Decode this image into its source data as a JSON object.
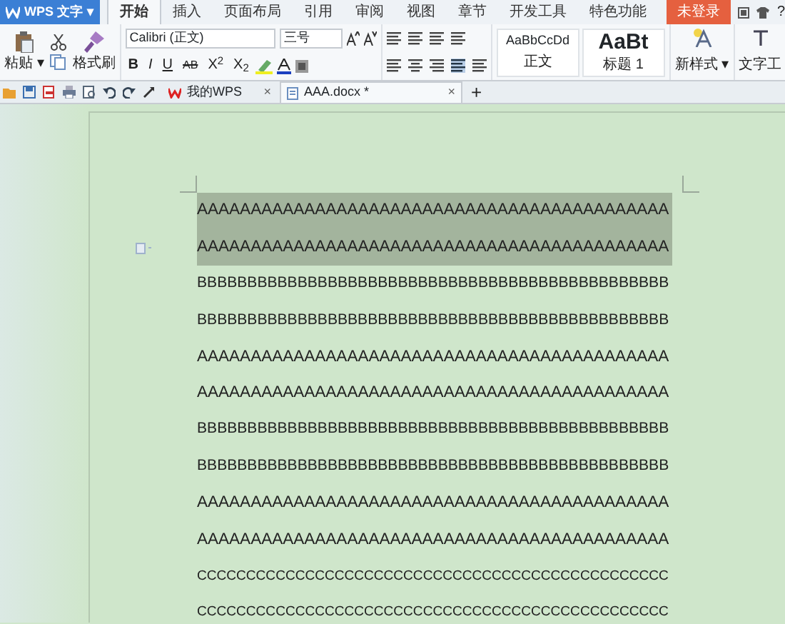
{
  "app_menu": {
    "label": "WPS 文字",
    "caret": "▾"
  },
  "ribbon_tabs": [
    {
      "label": "开始",
      "selected": true
    },
    {
      "label": "插入",
      "selected": false
    },
    {
      "label": "页面布局",
      "selected": false
    },
    {
      "label": "引用",
      "selected": false
    },
    {
      "label": "审阅",
      "selected": false
    },
    {
      "label": "视图",
      "selected": false
    },
    {
      "label": "章节",
      "selected": false
    },
    {
      "label": "开发工具",
      "selected": false
    },
    {
      "label": "特色功能",
      "selected": false
    }
  ],
  "login_button": "未登录",
  "help": "?",
  "ribbon": {
    "paste": "粘贴",
    "paste_caret": "▾",
    "format_painter": "格式刷",
    "font_name": "Calibri (正文)",
    "font_size": "三号",
    "format_buttons": [
      "B",
      "I",
      "U",
      "AB",
      "X$^{2}$",
      "X$_{2}$"
    ],
    "styles": [
      {
        "sample": "AaBbCcDd",
        "label": "正文",
        "kind": "small"
      },
      {
        "sample": "AaBt",
        "label": "标题 1",
        "kind": "large"
      }
    ],
    "new_style": "新样式",
    "new_style_caret": "▾",
    "text_tools": "文字工"
  },
  "doc_tabs": [
    {
      "label": "我的WPS",
      "close": "×",
      "selected": false
    },
    {
      "label": "AAA.docx *",
      "close": "×",
      "selected": true
    }
  ],
  "new_tab": "+",
  "lines": [
    {
      "text": "AAAAAAAAAAAAAAAAAAAAAAAAAAAAAAAAAAAAAAAAAAAA",
      "selected": true
    },
    {
      "text": "AAAAAAAAAAAAAAAAAAAAAAAAAAAAAAAAAAAAAAAAAAAA",
      "selected": true
    },
    {
      "text": "BBBBBBBBBBBBBBBBBBBBBBBBBBBBBBBBBBBBBBBBBBBBBBB",
      "selected": false
    },
    {
      "text": "BBBBBBBBBBBBBBBBBBBBBBBBBBBBBBBBBBBBBBBBBBBBBBB",
      "selected": false
    },
    {
      "text": "AAAAAAAAAAAAAAAAAAAAAAAAAAAAAAAAAAAAAAAAAAAA",
      "selected": false
    },
    {
      "text": "AAAAAAAAAAAAAAAAAAAAAAAAAAAAAAAAAAAAAAAAAAAA",
      "selected": false
    },
    {
      "text": "BBBBBBBBBBBBBBBBBBBBBBBBBBBBBBBBBBBBBBBBBBBBBBB",
      "selected": false
    },
    {
      "text": "BBBBBBBBBBBBBBBBBBBBBBBBBBBBBBBBBBBBBBBBBBBBBBB",
      "selected": false
    },
    {
      "text": "AAAAAAAAAAAAAAAAAAAAAAAAAAAAAAAAAAAAAAAAAAAA",
      "selected": false
    },
    {
      "text": "AAAAAAAAAAAAAAAAAAAAAAAAAAAAAAAAAAAAAAAAAAAA",
      "selected": false
    },
    {
      "text": "CCCCCCCCCCCCCCCCCCCCCCCCCCCCCCCCCCCCCCCCCCCCCCCC",
      "selected": false
    },
    {
      "text": "CCCCCCCCCCCCCCCCCCCCCCCCCCCCCCCCCCCCCCCCCCCCCCCC",
      "selected": false
    }
  ]
}
